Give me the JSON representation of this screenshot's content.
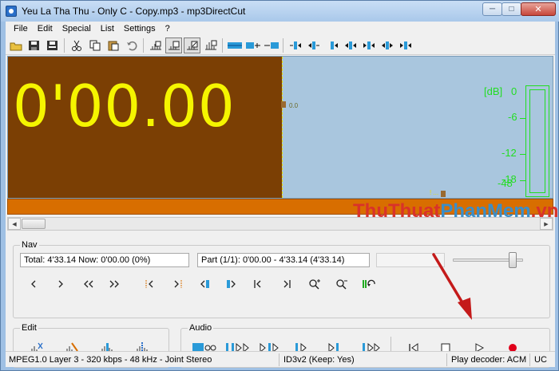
{
  "window": {
    "title": "Yeu La Tha Thu - Only C - Copy.mp3 - mp3DirectCut",
    "min_label": "─",
    "max_label": "□",
    "close_label": "✕"
  },
  "menu": {
    "items": [
      "File",
      "Edit",
      "Special",
      "List",
      "Settings",
      "?"
    ]
  },
  "toolbar": {
    "icons": [
      "open-icon",
      "save-icon",
      "save-split-icon",
      "cut-icon",
      "copy-icon",
      "paste-icon",
      "undo-icon",
      "insert-icon",
      "zoom-region-icon",
      "normalize-icon",
      "waveform-icon",
      "split-icon",
      "set-begin-icon",
      "set-end-icon",
      "goto-begin-icon",
      "goto-end-icon",
      "move-left-icon",
      "move-right-icon",
      "select-all-icon",
      "volume-icon",
      "level-icon"
    ]
  },
  "display": {
    "time": "0'00.00",
    "marker_value": "0.0",
    "end_marker_label": "! ...",
    "db_header": "[dB]",
    "db_levels": [
      "0",
      "-6",
      "-12",
      "-18",
      "-48"
    ]
  },
  "watermark": {
    "part_a": "ThuThuat",
    "part_b": "PhanMem",
    "part_c": ".vn"
  },
  "nav": {
    "title": "Nav",
    "total_now": "Total: 4'33.14   Now: 0'00.00   (0%)",
    "part": "Part (1/1): 0'00.00 - 4'33.14 (4'33.14)",
    "empty_field": "",
    "volume_level": 0.9
  },
  "edit": {
    "title": "Edit"
  },
  "audio": {
    "title": "Audio"
  },
  "status": {
    "format": "MPEG1.0 Layer 3 - 320 kbps - 48 kHz - Joint Stereo",
    "tag": "ID3v2 (Keep: Yes)",
    "decoder": "Play decoder: ACM",
    "mode": "UC"
  },
  "colors": {
    "time_color": "#f5f500",
    "wave_dark": "#7b3f04",
    "wave_light": "#a9c6de",
    "strip": "#d86e00",
    "meter": "#22dd22",
    "record": "#e0001a",
    "arrow": "#c41a1a"
  }
}
